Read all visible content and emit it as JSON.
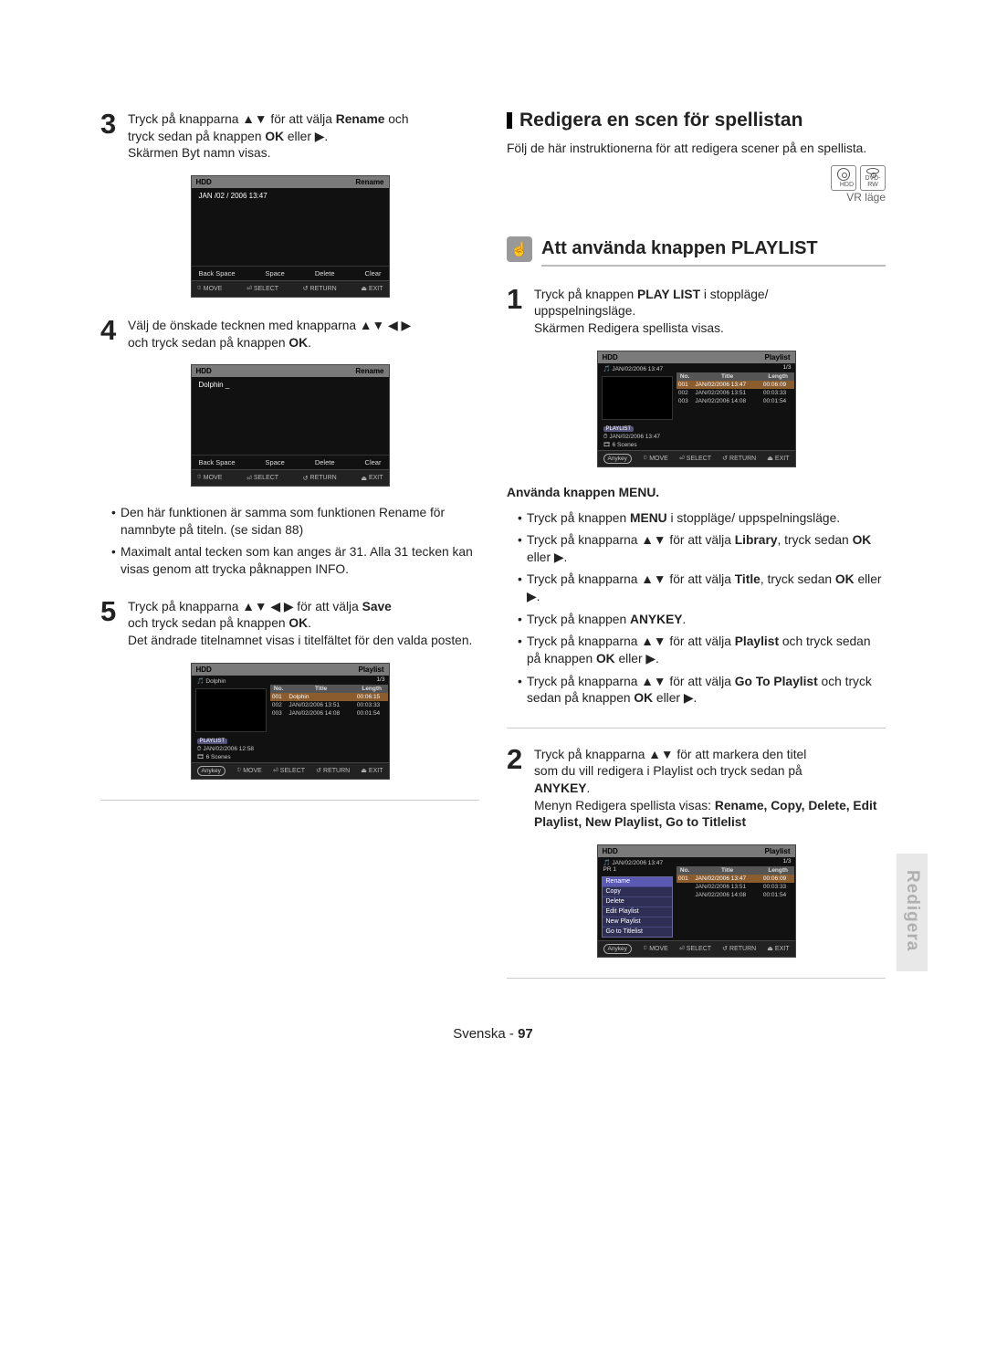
{
  "left": {
    "step3": {
      "num": "3",
      "l1a": "Tryck på knapparna ",
      "l1arrows": "▲▼",
      "l1b": " för att välja ",
      "l1bold": "Rename",
      "l1c": " och",
      "l2a": "tryck sedan på knappen ",
      "l2bold": "OK",
      "l2b": " eller ▶.",
      "l3": "Skärmen Byt namn visas."
    },
    "step4": {
      "num": "4",
      "l1a": "Välj de önskade tecknen med knapparna ",
      "l1arrows": "▲▼ ◀ ▶",
      "l2a": "och tryck sedan på knappen ",
      "l2bold": "OK",
      "l2b": "."
    },
    "notes": [
      "Den här funktionen är samma som funktionen Rename för namnbyte på titeln. (se sidan 88)",
      "Maximalt antal tecken som kan anges är 31. Alla 31 tecken kan visas genom att trycka påknappen INFO."
    ],
    "step5": {
      "num": "5",
      "l1a": "Tryck på knapparna ",
      "l1arrows": "▲▼ ◀ ▶",
      "l1b": "  för att välja ",
      "l1bold": "Save",
      "l2a": "och tryck sedan på knappen ",
      "l2bold": "OK",
      "l2b": ".",
      "l3": "Det ändrade titelnamnet visas i titelfältet för den valda posten."
    },
    "screen1": {
      "hdd": "HDD",
      "title": "Rename",
      "date": "JAN /02 / 2006  13:47",
      "b1": "Back Space",
      "b2": "Space",
      "b3": "Delete",
      "b4": "Clear",
      "f1": "MOVE",
      "f2": "SELECT",
      "f3": "RETURN",
      "f4": "EXIT"
    },
    "screen2": {
      "hdd": "HDD",
      "title": "Rename",
      "text": "Dolphin _",
      "b1": "Back Space",
      "b2": "Space",
      "b3": "Delete",
      "b4": "Clear",
      "f1": "MOVE",
      "f2": "SELECT",
      "f3": "RETURN",
      "f4": "EXIT"
    },
    "screen3": {
      "hdd": "HDD",
      "title": "Playlist",
      "sub": "Dolphin",
      "count": "1/3",
      "cols": [
        "No.",
        "Title",
        "Length"
      ],
      "rows": [
        [
          "001",
          "Dolphin",
          "00:06:15"
        ],
        [
          "002",
          "JAN/02/2006 13:51",
          "00:03:33"
        ],
        [
          "003",
          "JAN/02/2006 14:08",
          "00:01:54"
        ]
      ],
      "info1": "JAN/02/2006 12:58",
      "info2": "6 Scenes",
      "anykey": "Anykey",
      "f1": "MOVE",
      "f2": "SELECT",
      "f3": "RETURN",
      "f4": "EXIT"
    }
  },
  "right": {
    "section_title": "Redigera en scen för spellistan",
    "intro": "Följ de här instruktionerna för att redigera scener på en spellista.",
    "disc1": "HDD",
    "disc2": "DVD-RW",
    "vr": "VR läge",
    "subsection": "Att använda knappen PLAYLIST",
    "step1": {
      "num": "1",
      "l1a": "Tryck på knappen ",
      "l1bold": "PLAY LIST",
      "l1b": " i stoppläge/",
      "l2": "uppspelningsläge.",
      "l3": "Skärmen Redigera spellista visas."
    },
    "menuHeading": "Använda knappen MENU.",
    "bullets": {
      "m1a": "Tryck på knappen ",
      "m1bold": "MENU",
      "m1b": " i stoppläge/ uppspelningsläge.",
      "m2a": "Tryck på knapparna ▲▼ för att välja ",
      "m2bold": "Library",
      "m2b": ", tryck sedan ",
      "m2ok": "OK",
      "m2c": " eller ▶.",
      "m3a": "Tryck på knapparna ▲▼ för att välja ",
      "m3bold": "Title",
      "m3b": ", tryck sedan ",
      "m3ok": "OK",
      "m3c": " eller ▶.",
      "m4a": "Tryck på knappen ",
      "m4bold": "ANYKEY",
      "m4b": ".",
      "m5a": "Tryck på knapparna ▲▼ för att välja ",
      "m5bold": "Playlist",
      "m5b": " och tryck sedan på knappen ",
      "m5ok": "OK",
      "m5c": " eller ▶.",
      "m6a": "Tryck på knapparna ▲▼ för att välja ",
      "m6bold": "Go To Playlist",
      "m6b": " och tryck sedan på knappen ",
      "m6ok": "OK",
      "m6c": " eller ▶."
    },
    "step2": {
      "num": "2",
      "l1a": "Tryck på knapparna ▲▼ för att markera den titel",
      "l2": "som du vill redigera i Playlist och tryck sedan på",
      "l3bold": "ANYKEY",
      "l3b": ".",
      "l4a": "Menyn Redigera spellista visas: ",
      "l4bold": "Rename, Copy, Delete, Edit Playlist, New Playlist, Go to Titlelist"
    },
    "screenP1": {
      "hdd": "HDD",
      "title": "Playlist",
      "sub": "JAN/02/2006 13:47",
      "count": "1/3",
      "cols": [
        "No.",
        "Title",
        "Length"
      ],
      "rows": [
        [
          "001",
          "JAN/02/2006 13:47",
          "00:06:09"
        ],
        [
          "002",
          "JAN/02/2006 13:51",
          "00:03:33"
        ],
        [
          "003",
          "JAN/02/2006 14:08",
          "00:01:54"
        ]
      ],
      "info1": "JAN/02/2006 13:47",
      "info2": "6 Scenes",
      "anykey": "Anykey",
      "f1": "MOVE",
      "f2": "SELECT",
      "f3": "RETURN",
      "f4": "EXIT"
    },
    "screenP2": {
      "hdd": "HDD",
      "title": "Playlist",
      "sub": "JAN/02/2006 13:47 PR 1",
      "count": "1/3",
      "cols": [
        "No.",
        "Title",
        "Length"
      ],
      "rows": [
        [
          "001",
          "JAN/02/2006 13:47",
          "00:06:09"
        ],
        [
          "",
          "JAN/02/2006 13:51",
          "00:03:33"
        ],
        [
          "",
          "JAN/02/2006 14:08",
          "00:01:54"
        ]
      ],
      "menu": [
        "Rename",
        "Copy",
        "Delete",
        "Edit Playlist",
        "New Playlist",
        "Go to Titlelist"
      ],
      "anykey": "Anykey",
      "f1": "MOVE",
      "f2": "SELECT",
      "f3": "RETURN",
      "f4": "EXIT"
    }
  },
  "side_tab": "Redigera",
  "footer": {
    "lang": "Svenska",
    "sep": " - ",
    "pageno": "97"
  }
}
